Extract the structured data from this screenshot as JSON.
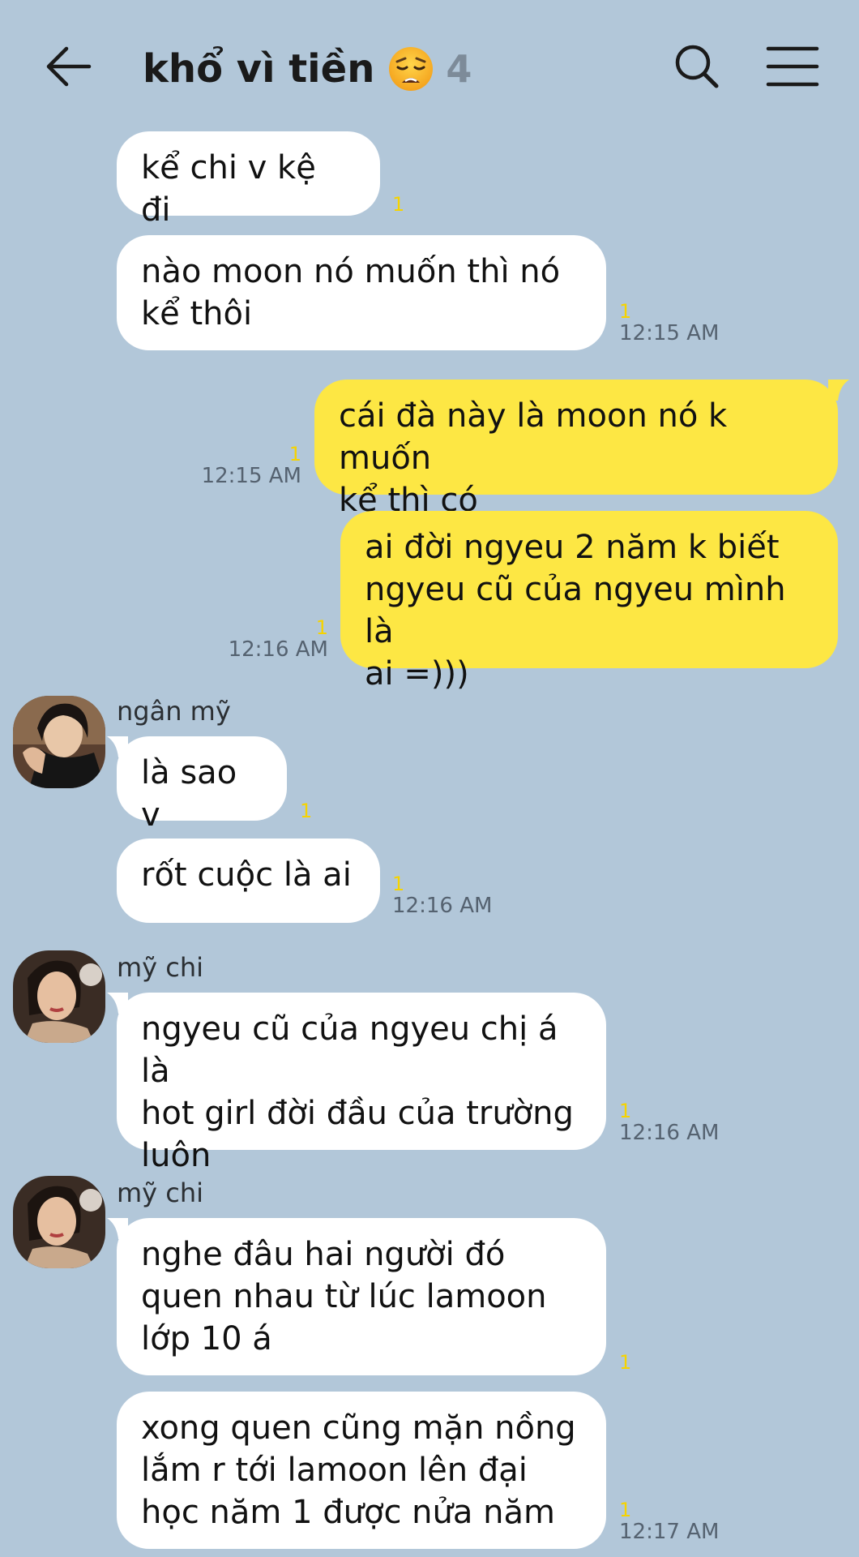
{
  "header": {
    "title": "khổ vì tiền",
    "member_count": "4",
    "back_icon": "arrow-left-icon",
    "search_icon": "search-icon",
    "menu_icon": "menu-icon",
    "emoji": "weary-face"
  },
  "colors": {
    "background": "#b2c7d9",
    "incoming_bubble": "#ffffff",
    "outgoing_bubble": "#fde744",
    "unread_count": "#f6d300",
    "timestamp": "#556270"
  },
  "messages": [
    {
      "id": "m1",
      "side": "left",
      "text": "kể chi v kệ đi",
      "read": "1",
      "time": ""
    },
    {
      "id": "m2",
      "side": "left",
      "text": "nào moon nó muốn thì nó\nkể thôi",
      "read": "1",
      "time": "12:15 AM"
    },
    {
      "id": "m3",
      "side": "right",
      "text": "cái đà này là moon nó k muốn\nkể thì có",
      "read": "1",
      "time": "12:15 AM"
    },
    {
      "id": "m4",
      "side": "right",
      "text": "ai đời ngyeu 2 năm k biết\nngyeu cũ của ngyeu mình là\nai =)))",
      "read": "1",
      "time": "12:16 AM"
    },
    {
      "id": "m5",
      "side": "left",
      "sender": "ngân mỹ",
      "text": "là sao v",
      "read": "1",
      "time": ""
    },
    {
      "id": "m6",
      "side": "left",
      "text": "rốt cuộc là ai",
      "read": "1",
      "time": "12:16 AM"
    },
    {
      "id": "m7",
      "side": "left",
      "sender": "mỹ chi",
      "text": "ngyeu cũ của ngyeu chị á là\nhot girl đời đầu của trường\nluôn",
      "read": "1",
      "time": "12:16 AM"
    },
    {
      "id": "m8",
      "side": "left",
      "sender": "mỹ chi",
      "text": "nghe đâu hai người đó\nquen nhau từ lúc lamoon\nlớp 10 á",
      "read": "1",
      "time": ""
    },
    {
      "id": "m9",
      "side": "left",
      "text": "xong quen cũng mặn nồng\nlắm r tới lamoon lên đại\nhọc năm 1 được nửa năm",
      "read": "1",
      "time": "12:17 AM"
    }
  ]
}
